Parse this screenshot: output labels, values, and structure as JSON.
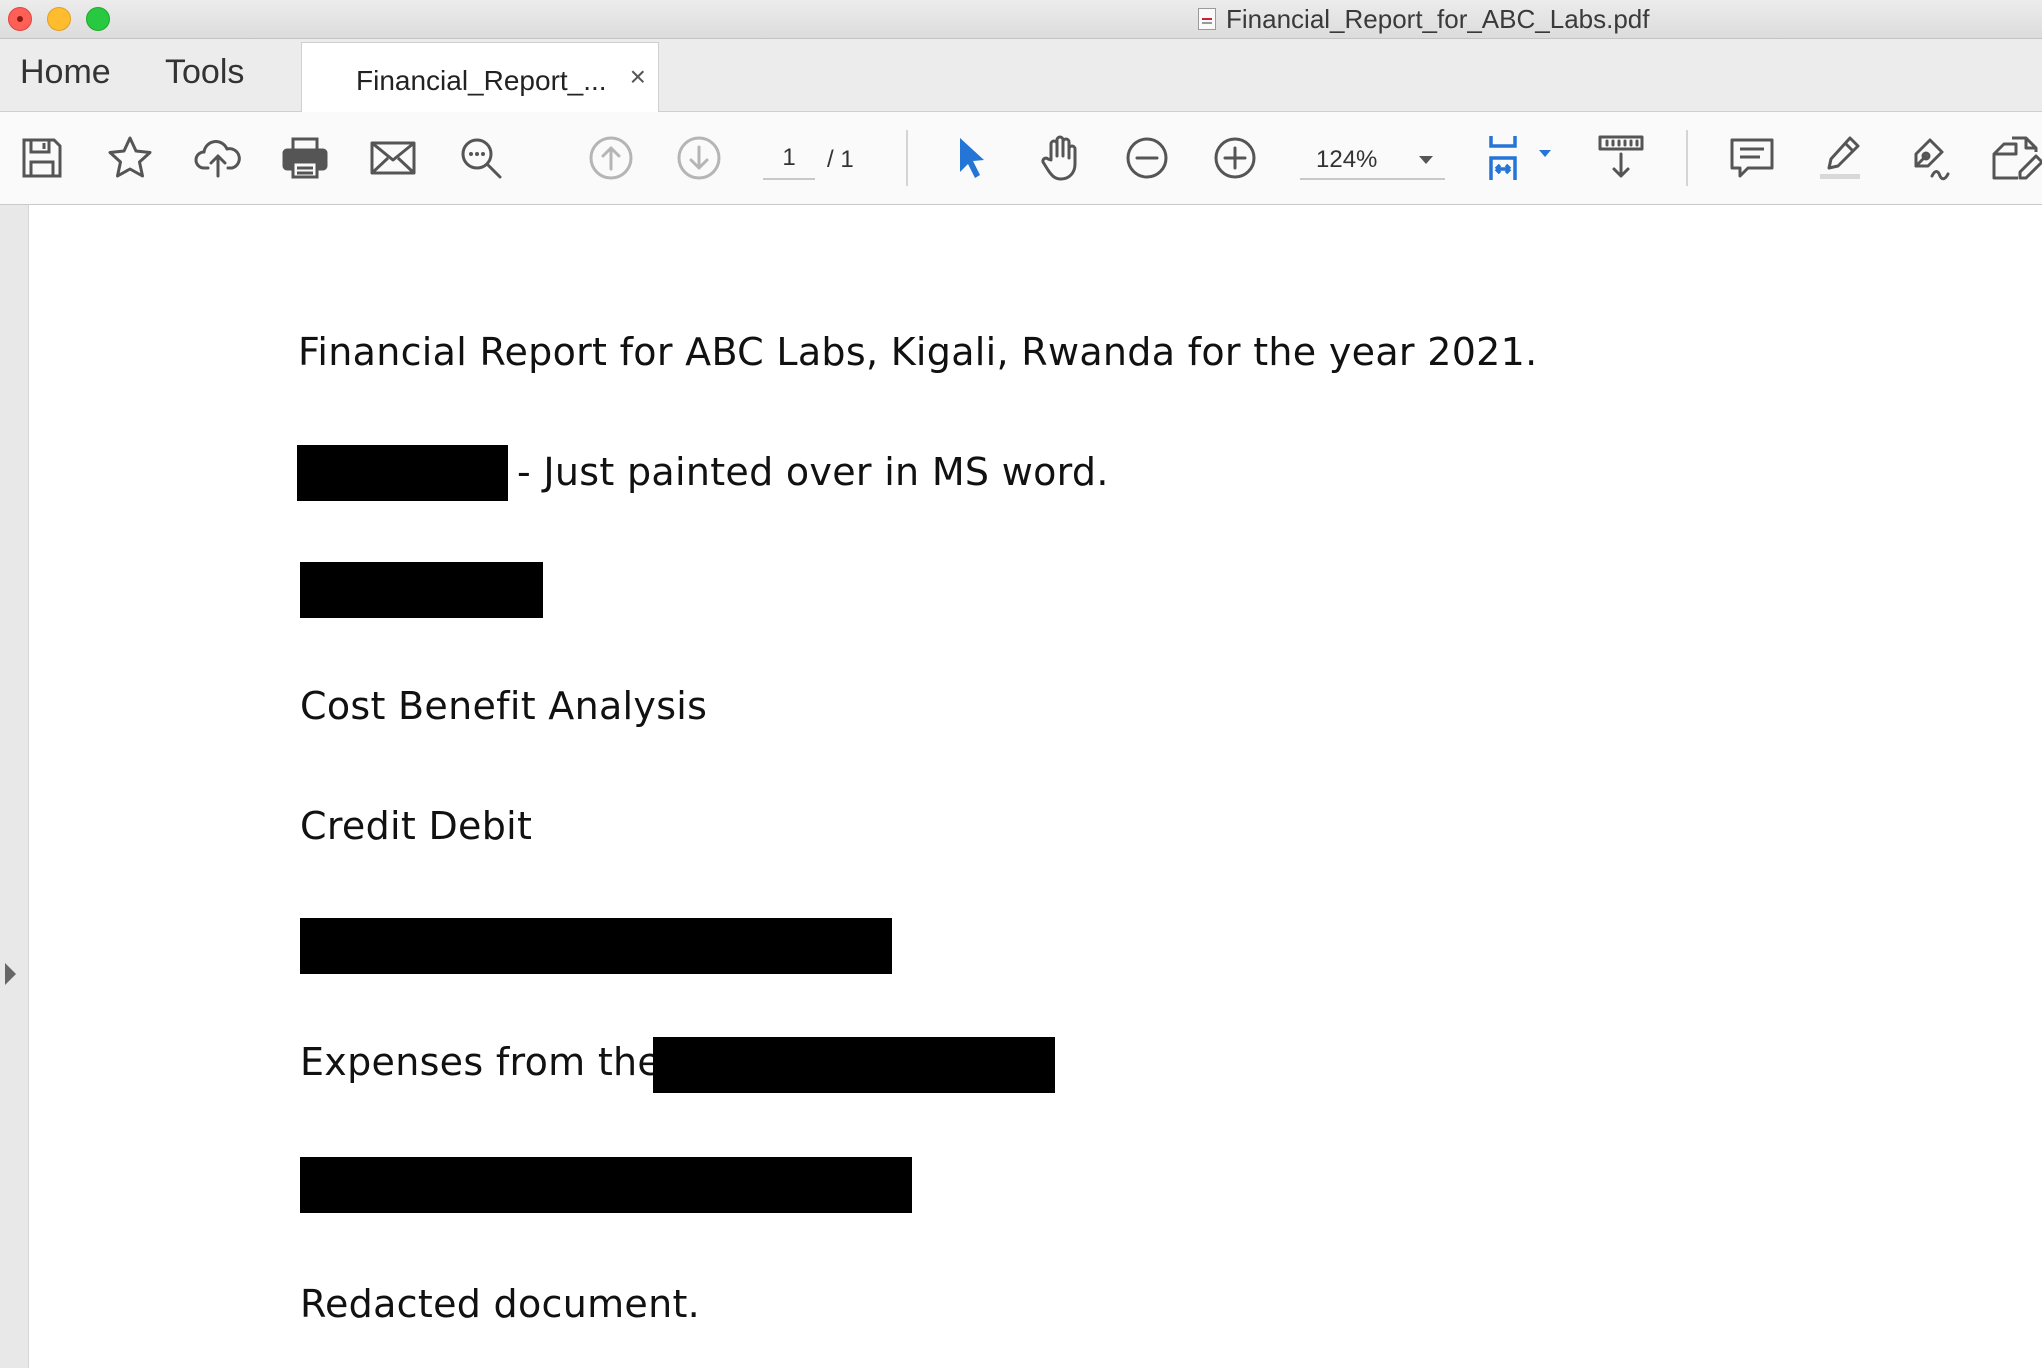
{
  "window": {
    "title": "Financial_Report_for_ABC_Labs.pdf"
  },
  "tabs": {
    "home": "Home",
    "tools": "Tools",
    "document_tab": "Financial_Report_...",
    "close_glyph": "×"
  },
  "toolbar": {
    "page_current": "1",
    "page_total": "/  1",
    "zoom": "124%",
    "icons": [
      "save-icon",
      "bookmark-star-icon",
      "upload-cloud-icon",
      "print-icon",
      "email-icon",
      "search-icon",
      "previous-page-icon",
      "next-page-icon",
      "select-cursor-icon",
      "hand-tool-icon",
      "zoom-out-icon",
      "zoom-in-icon",
      "fit-page-icon",
      "scroll-mode-icon",
      "comment-icon",
      "highlight-icon",
      "sign-icon",
      "edit-pdf-icon"
    ],
    "accent_color": "#2475d6"
  },
  "document": {
    "line1": "Financial Report for ABC Labs, Kigali, Rwanda for the year 2021.",
    "line2": "- Just painted over in MS word.",
    "heading_cost": "Cost Benefit Analysis",
    "heading_credit": "Credit Debit",
    "expenses_prefix": "Expenses from the",
    "footer": "Redacted document."
  }
}
